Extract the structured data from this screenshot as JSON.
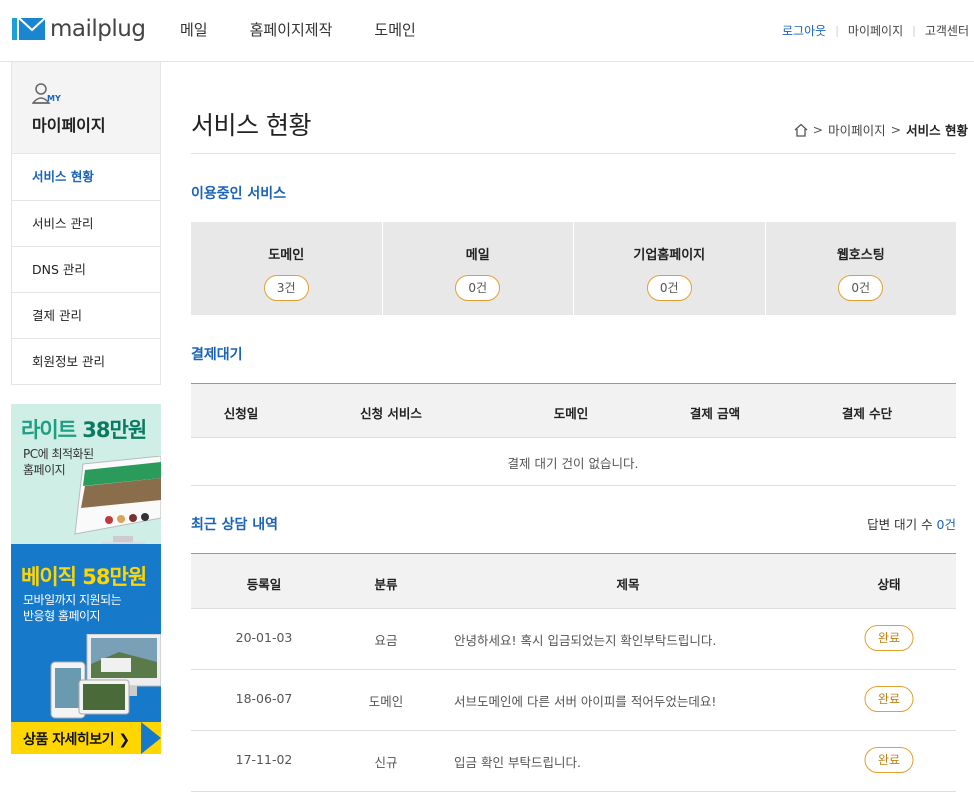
{
  "header": {
    "logo_text": "mailplug",
    "nav": [
      "메일",
      "홈페이지제작",
      "도메인"
    ],
    "util": {
      "logout": "로그아웃",
      "mypage": "마이페이지",
      "support": "고객센터"
    }
  },
  "sidebar": {
    "my_badge": "MY",
    "title": "마이페이지",
    "items": [
      {
        "label": "서비스 현황",
        "active": true
      },
      {
        "label": "서비스 관리",
        "active": false
      },
      {
        "label": "DNS 관리",
        "active": false
      },
      {
        "label": "결제 관리",
        "active": false
      },
      {
        "label": "회원정보 관리",
        "active": false
      }
    ]
  },
  "banner": {
    "top_title_a": "라이트 ",
    "top_title_b": "38만원",
    "top_sub": [
      "PC에 최적화된",
      "홈페이지"
    ],
    "bottom_title": "베이직 58만원",
    "bottom_sub": [
      "모바일까지 지원되는",
      "반응형 홈페이지"
    ],
    "cta": "상품 자세히보기 ❯"
  },
  "page": {
    "title": "서비스 현황",
    "breadcrumb": [
      "마이페이지",
      "서비스 현황"
    ]
  },
  "services": {
    "title": "이용중인 서비스",
    "items": [
      {
        "name": "도메인",
        "count": "3건"
      },
      {
        "name": "메일",
        "count": "0건"
      },
      {
        "name": "기업홈페이지",
        "count": "0건"
      },
      {
        "name": "웹호스팅",
        "count": "0건"
      }
    ]
  },
  "payment": {
    "title": "결제대기",
    "headers": [
      "신청일",
      "신청 서비스",
      "도메인",
      "결제 금액",
      "결제 수단"
    ],
    "empty": "결제 대기 건이 없습니다."
  },
  "consult": {
    "title": "최근 상담 내역",
    "wait_label": "답변 대기 수 ",
    "wait_count": "0건",
    "headers": [
      "등록일",
      "분류",
      "제목",
      "상태"
    ],
    "rows": [
      {
        "date": "20-01-03",
        "category": "요금",
        "subject": "안녕하세요! 혹시 입금되었는지 확인부탁드립니다.",
        "status": "완료"
      },
      {
        "date": "18-06-07",
        "category": "도메인",
        "subject": "서브도메인에 다른 서버 아이피를 적어두었는데요!",
        "status": "완료"
      },
      {
        "date": "17-11-02",
        "category": "신규",
        "subject": "입금 확인 부탁드립니다.",
        "status": "완료"
      }
    ]
  },
  "colors": {
    "accent": "#1a63b8",
    "pill_border": "#e2a033",
    "banner_green": "#cfeee6",
    "banner_blue": "#1779c9",
    "banner_yellow": "#ffd600"
  }
}
